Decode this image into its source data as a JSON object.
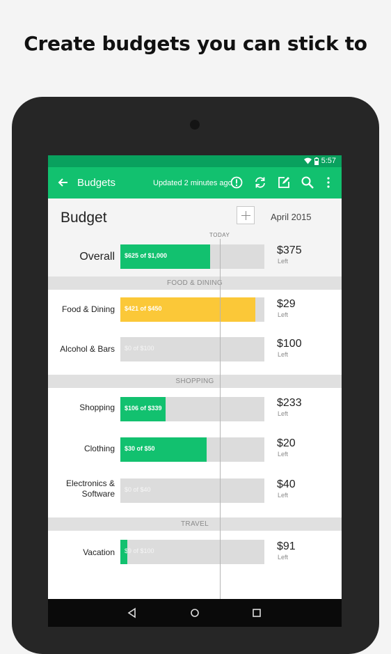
{
  "headline": "Create budgets you can stick to",
  "status_bar": {
    "time": "5:57",
    "icons": [
      "wifi-icon",
      "battery-icon"
    ]
  },
  "app_bar": {
    "title": "Budgets",
    "updated_text": "Updated 2 minutes ago",
    "actions": [
      "alert-icon",
      "refresh-icon",
      "edit-icon",
      "search-icon",
      "more-vert-icon"
    ]
  },
  "budget": {
    "title": "Budget",
    "month": "April 2015",
    "today_label": "TODAY",
    "left_word": "Left",
    "overall": {
      "label": "Overall",
      "bar_text": "$625 of $1,000",
      "left": "$375",
      "progress": 0.625,
      "color": "#12c16f"
    },
    "sections": [
      {
        "title": "FOOD & DINING",
        "items": [
          {
            "label": "Food & Dining",
            "bar_text": "$421 of $450",
            "left": "$29",
            "progress": 0.9355,
            "color": "#fbc838"
          },
          {
            "label": "Alcohol & Bars",
            "bar_text": "$0 of $100",
            "left": "$100",
            "progress": 0,
            "color": "#12c16f"
          }
        ]
      },
      {
        "title": "SHOPPING",
        "items": [
          {
            "label": "Shopping",
            "bar_text": "$106 of $339",
            "left": "$233",
            "progress": 0.3127,
            "color": "#12c16f"
          },
          {
            "label": "Clothing",
            "bar_text": "$30 of $50",
            "left": "$20",
            "progress": 0.6,
            "color": "#12c16f"
          },
          {
            "label": "Electronics & Software",
            "bar_text": "$0 of $40",
            "left": "$40",
            "progress": 0,
            "color": "#12c16f"
          }
        ]
      },
      {
        "title": "TRAVEL",
        "items": [
          {
            "label": "Vacation",
            "bar_text": "$9 of $100",
            "left": "$91",
            "progress": 0.05,
            "color": "#12c16f"
          }
        ]
      }
    ]
  },
  "nav_bar": [
    "back-triangle-icon",
    "home-circle-icon",
    "recents-square-icon"
  ],
  "colors": {
    "accent": "#12c16f",
    "status_bar": "#09a15e",
    "warning": "#fbc838",
    "track": "#dcdcdc",
    "section_bg": "#e0e0e0"
  }
}
